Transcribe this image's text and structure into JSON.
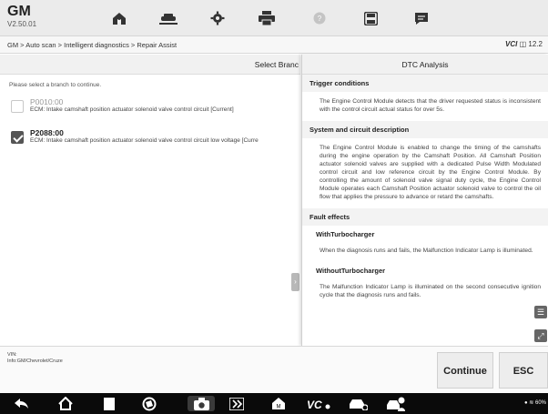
{
  "header": {
    "title": "GM",
    "version": "V2.50.01",
    "toolbar": [
      "home-icon",
      "vehicle-lift-icon",
      "settings-icon",
      "print-icon",
      "help-icon",
      "save-icon",
      "message-icon"
    ]
  },
  "breadcrumb": {
    "path": "GM > Auto scan > Intelligent diagnostics > Repair Assist",
    "vci_label": "VCI",
    "battery_value": "12.2"
  },
  "left_panel": {
    "title": "Select Branc",
    "hint": "Please select a branch to continue.",
    "branches": [
      {
        "code": "P0010:00",
        "desc": "ECM: Intake camshaft position actuator solenoid valve control circuit [Current]",
        "checked": false
      },
      {
        "code": "P2088:00",
        "desc": "ECM: Intake camshaft position actuator solenoid valve control circuit low voltage [Curre",
        "checked": true
      }
    ]
  },
  "right_panel": {
    "title": "DTC Analysis",
    "sections": {
      "trigger_h": "Trigger conditions",
      "trigger_p": "The Engine Control Module detects that the driver requested status is inconsistent with the control circuit actual status for over 5s.",
      "system_h": "System and circuit description",
      "system_p": "The Engine Control Module is enabled to change the timing of the camshafts during the engine operation by the Camshaft Position. All Camshaft Position actuator solenoid valves are supplied with a dedicated Pulse Width Modulated control circuit and low reference circuit by the Engine Control Module. By controlling the amount of solenoid valve signal duty cycle, the Engine Control Module operates each Camshaft Position actuator solenoid valve to control the oil flow that applies the pressure to advance or retard the camshafts.",
      "fault_h": "Fault effects",
      "with_h": "WithTurbocharger",
      "with_p": "When the diagnosis runs and fails, the Malfunction Indicator Lamp is illuminated.",
      "without_h": "WithoutTurbocharger",
      "without_p": "The Malfunction Indicator Lamp is illuminated on the second consecutive ignition cycle that the diagnosis runs and fails."
    }
  },
  "info": {
    "vin_label": "VIN:",
    "vehicle": "Info:GM/Chevrolet/Cruze"
  },
  "buttons": {
    "continue": "Continue",
    "esc": "ESC"
  },
  "status": {
    "battery": "60%"
  },
  "colors": {
    "header_bg": "#ebebeb",
    "nav_bg": "#0a0a0a",
    "check_on": "#555555"
  }
}
